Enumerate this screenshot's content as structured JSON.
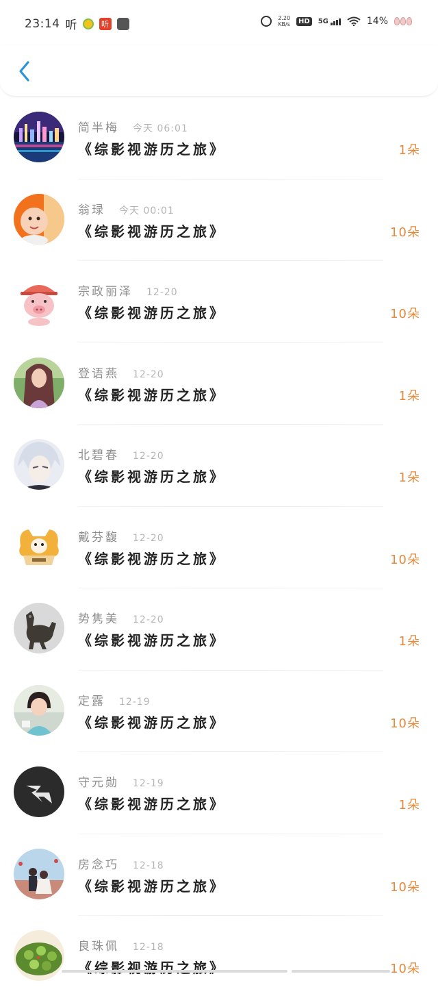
{
  "status_bar": {
    "time": "23:14",
    "app_text": "听",
    "red_icon_text": "听",
    "speed_top": "2.20",
    "speed_bottom": "KB/s",
    "hd": "HD",
    "network": "5G",
    "battery": "14%"
  },
  "header": {
    "back_icon": "chevron-left-icon",
    "accent_color": "#2c93d9"
  },
  "colors": {
    "count": "#e58a3d",
    "name": "#8e8e8e",
    "time": "#b5b5b5"
  },
  "entries": [
    {
      "name": "简半梅",
      "time": "今天 06:01",
      "title": "《综影视游历之旅》",
      "count": "1朵",
      "avatar": "city-night-avatar"
    },
    {
      "name": "翁琭",
      "time": "今天 00:01",
      "title": "《综影视游历之旅》",
      "count": "10朵",
      "avatar": "baby-avatar"
    },
    {
      "name": "宗政丽泽",
      "time": "12-20",
      "title": "《综影视游历之旅》",
      "count": "10朵",
      "avatar": "pig-avatar"
    },
    {
      "name": "登语燕",
      "time": "12-20",
      "title": "《综影视游历之旅》",
      "count": "1朵",
      "avatar": "girl-avatar"
    },
    {
      "name": "北碧春",
      "time": "12-20",
      "title": "《综影视游历之旅》",
      "count": "1朵",
      "avatar": "anime-avatar"
    },
    {
      "name": "戴芬馥",
      "time": "12-20",
      "title": "《综影视游历之旅》",
      "count": "10朵",
      "avatar": "cat-avatar"
    },
    {
      "name": "势隽美",
      "time": "12-20",
      "title": "《综影视游历之旅》",
      "count": "1朵",
      "avatar": "bronze-avatar"
    },
    {
      "name": "定露",
      "time": "12-19",
      "title": "《综影视游历之旅》",
      "count": "10朵",
      "avatar": "child-avatar"
    },
    {
      "name": "守元勋",
      "time": "12-19",
      "title": "《综影视游历之旅》",
      "count": "1朵",
      "avatar": "lightning-avatar"
    },
    {
      "name": "房念巧",
      "time": "12-18",
      "title": "《综影视游历之旅》",
      "count": "10朵",
      "avatar": "couple-avatar"
    },
    {
      "name": "良珠佩",
      "time": "12-18",
      "title": "《综影视游历之旅》",
      "count": "10朵",
      "avatar": "food-avatar"
    }
  ]
}
